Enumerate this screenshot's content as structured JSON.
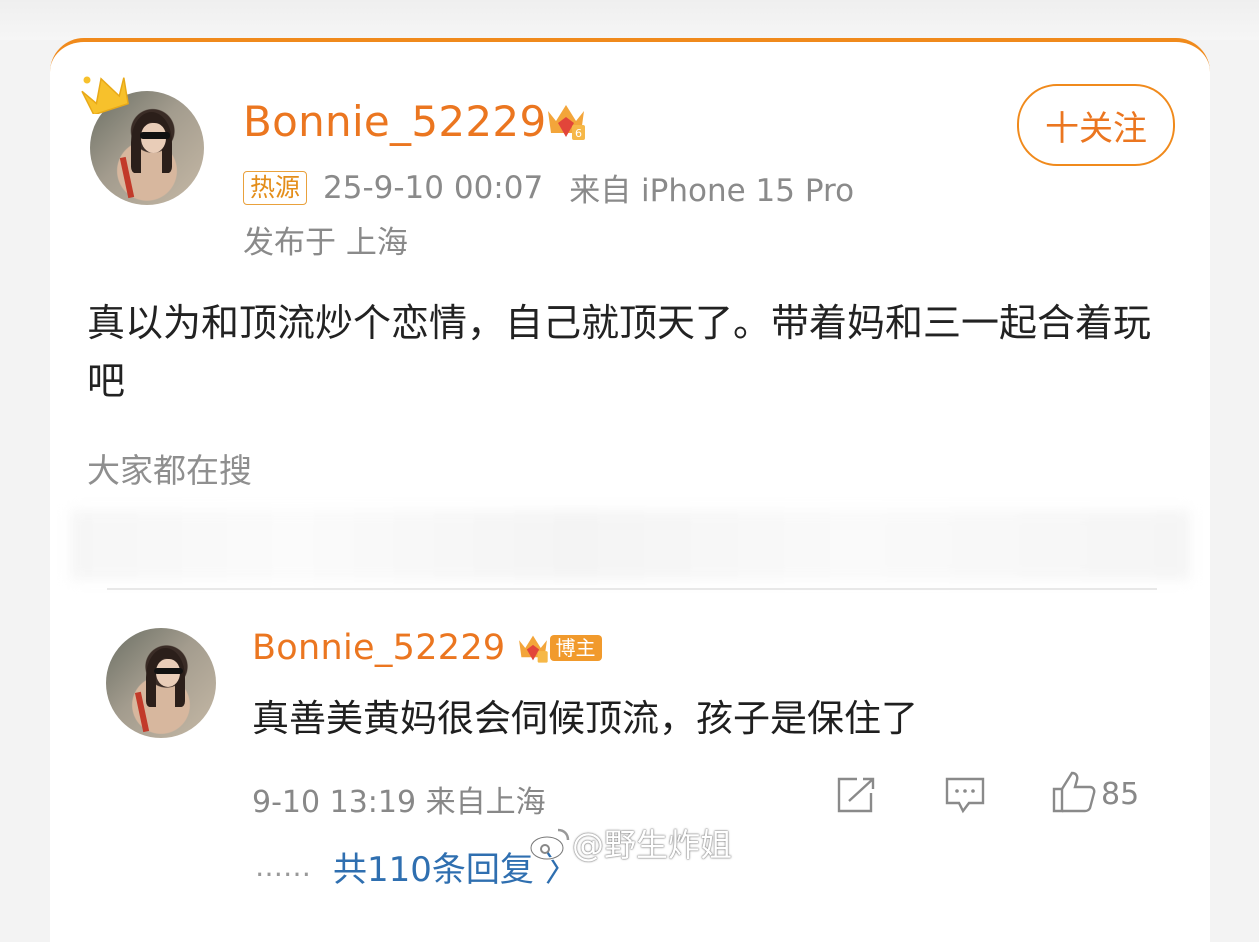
{
  "post": {
    "username": "Bonnie_52229",
    "hot_badge": "热源",
    "timestamp": "25-9-10 00:07",
    "source": "来自 iPhone 15 Pro",
    "location": "发布于 上海",
    "follow_label": "十关注",
    "content": "真以为和顶流炒个恋情，自己就顶天了。带着妈和三一起合着玩吧",
    "search_label": "大家都在搜"
  },
  "comment": {
    "username": "Bonnie_52229",
    "role_badge": "博主",
    "text": "真善美黄妈很会伺候顶流，孩子是保住了",
    "time_location": "9-10 13:19 来自上海",
    "like_count": "85"
  },
  "footer": {
    "more_replies_prefix": "……",
    "more_replies": "共110条回复 〉"
  },
  "watermark": "@野生炸姐",
  "colors": {
    "accent": "#eb7620",
    "card_top_border": "#f08a1c",
    "link": "#2f6fb0"
  },
  "icons": [
    "crown-icon",
    "vip-crown-badge-icon",
    "repost-icon",
    "comment-icon",
    "like-icon",
    "weibo-logo-icon"
  ]
}
